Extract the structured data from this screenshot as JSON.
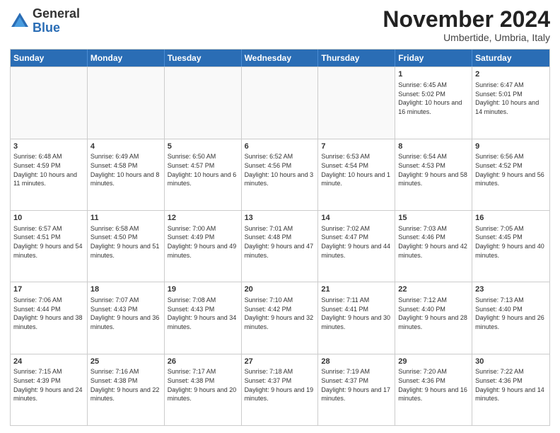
{
  "header": {
    "logo_general": "General",
    "logo_blue": "Blue",
    "month": "November 2024",
    "location": "Umbertide, Umbria, Italy"
  },
  "days_of_week": [
    "Sunday",
    "Monday",
    "Tuesday",
    "Wednesday",
    "Thursday",
    "Friday",
    "Saturday"
  ],
  "rows": [
    [
      {
        "day": "",
        "info": "",
        "empty": true
      },
      {
        "day": "",
        "info": "",
        "empty": true
      },
      {
        "day": "",
        "info": "",
        "empty": true
      },
      {
        "day": "",
        "info": "",
        "empty": true
      },
      {
        "day": "",
        "info": "",
        "empty": true
      },
      {
        "day": "1",
        "info": "Sunrise: 6:45 AM\nSunset: 5:02 PM\nDaylight: 10 hours and 16 minutes.",
        "empty": false
      },
      {
        "day": "2",
        "info": "Sunrise: 6:47 AM\nSunset: 5:01 PM\nDaylight: 10 hours and 14 minutes.",
        "empty": false
      }
    ],
    [
      {
        "day": "3",
        "info": "Sunrise: 6:48 AM\nSunset: 4:59 PM\nDaylight: 10 hours and 11 minutes.",
        "empty": false
      },
      {
        "day": "4",
        "info": "Sunrise: 6:49 AM\nSunset: 4:58 PM\nDaylight: 10 hours and 8 minutes.",
        "empty": false
      },
      {
        "day": "5",
        "info": "Sunrise: 6:50 AM\nSunset: 4:57 PM\nDaylight: 10 hours and 6 minutes.",
        "empty": false
      },
      {
        "day": "6",
        "info": "Sunrise: 6:52 AM\nSunset: 4:56 PM\nDaylight: 10 hours and 3 minutes.",
        "empty": false
      },
      {
        "day": "7",
        "info": "Sunrise: 6:53 AM\nSunset: 4:54 PM\nDaylight: 10 hours and 1 minute.",
        "empty": false
      },
      {
        "day": "8",
        "info": "Sunrise: 6:54 AM\nSunset: 4:53 PM\nDaylight: 9 hours and 58 minutes.",
        "empty": false
      },
      {
        "day": "9",
        "info": "Sunrise: 6:56 AM\nSunset: 4:52 PM\nDaylight: 9 hours and 56 minutes.",
        "empty": false
      }
    ],
    [
      {
        "day": "10",
        "info": "Sunrise: 6:57 AM\nSunset: 4:51 PM\nDaylight: 9 hours and 54 minutes.",
        "empty": false
      },
      {
        "day": "11",
        "info": "Sunrise: 6:58 AM\nSunset: 4:50 PM\nDaylight: 9 hours and 51 minutes.",
        "empty": false
      },
      {
        "day": "12",
        "info": "Sunrise: 7:00 AM\nSunset: 4:49 PM\nDaylight: 9 hours and 49 minutes.",
        "empty": false
      },
      {
        "day": "13",
        "info": "Sunrise: 7:01 AM\nSunset: 4:48 PM\nDaylight: 9 hours and 47 minutes.",
        "empty": false
      },
      {
        "day": "14",
        "info": "Sunrise: 7:02 AM\nSunset: 4:47 PM\nDaylight: 9 hours and 44 minutes.",
        "empty": false
      },
      {
        "day": "15",
        "info": "Sunrise: 7:03 AM\nSunset: 4:46 PM\nDaylight: 9 hours and 42 minutes.",
        "empty": false
      },
      {
        "day": "16",
        "info": "Sunrise: 7:05 AM\nSunset: 4:45 PM\nDaylight: 9 hours and 40 minutes.",
        "empty": false
      }
    ],
    [
      {
        "day": "17",
        "info": "Sunrise: 7:06 AM\nSunset: 4:44 PM\nDaylight: 9 hours and 38 minutes.",
        "empty": false
      },
      {
        "day": "18",
        "info": "Sunrise: 7:07 AM\nSunset: 4:43 PM\nDaylight: 9 hours and 36 minutes.",
        "empty": false
      },
      {
        "day": "19",
        "info": "Sunrise: 7:08 AM\nSunset: 4:43 PM\nDaylight: 9 hours and 34 minutes.",
        "empty": false
      },
      {
        "day": "20",
        "info": "Sunrise: 7:10 AM\nSunset: 4:42 PM\nDaylight: 9 hours and 32 minutes.",
        "empty": false
      },
      {
        "day": "21",
        "info": "Sunrise: 7:11 AM\nSunset: 4:41 PM\nDaylight: 9 hours and 30 minutes.",
        "empty": false
      },
      {
        "day": "22",
        "info": "Sunrise: 7:12 AM\nSunset: 4:40 PM\nDaylight: 9 hours and 28 minutes.",
        "empty": false
      },
      {
        "day": "23",
        "info": "Sunrise: 7:13 AM\nSunset: 4:40 PM\nDaylight: 9 hours and 26 minutes.",
        "empty": false
      }
    ],
    [
      {
        "day": "24",
        "info": "Sunrise: 7:15 AM\nSunset: 4:39 PM\nDaylight: 9 hours and 24 minutes.",
        "empty": false
      },
      {
        "day": "25",
        "info": "Sunrise: 7:16 AM\nSunset: 4:38 PM\nDaylight: 9 hours and 22 minutes.",
        "empty": false
      },
      {
        "day": "26",
        "info": "Sunrise: 7:17 AM\nSunset: 4:38 PM\nDaylight: 9 hours and 20 minutes.",
        "empty": false
      },
      {
        "day": "27",
        "info": "Sunrise: 7:18 AM\nSunset: 4:37 PM\nDaylight: 9 hours and 19 minutes.",
        "empty": false
      },
      {
        "day": "28",
        "info": "Sunrise: 7:19 AM\nSunset: 4:37 PM\nDaylight: 9 hours and 17 minutes.",
        "empty": false
      },
      {
        "day": "29",
        "info": "Sunrise: 7:20 AM\nSunset: 4:36 PM\nDaylight: 9 hours and 16 minutes.",
        "empty": false
      },
      {
        "day": "30",
        "info": "Sunrise: 7:22 AM\nSunset: 4:36 PM\nDaylight: 9 hours and 14 minutes.",
        "empty": false
      }
    ]
  ]
}
